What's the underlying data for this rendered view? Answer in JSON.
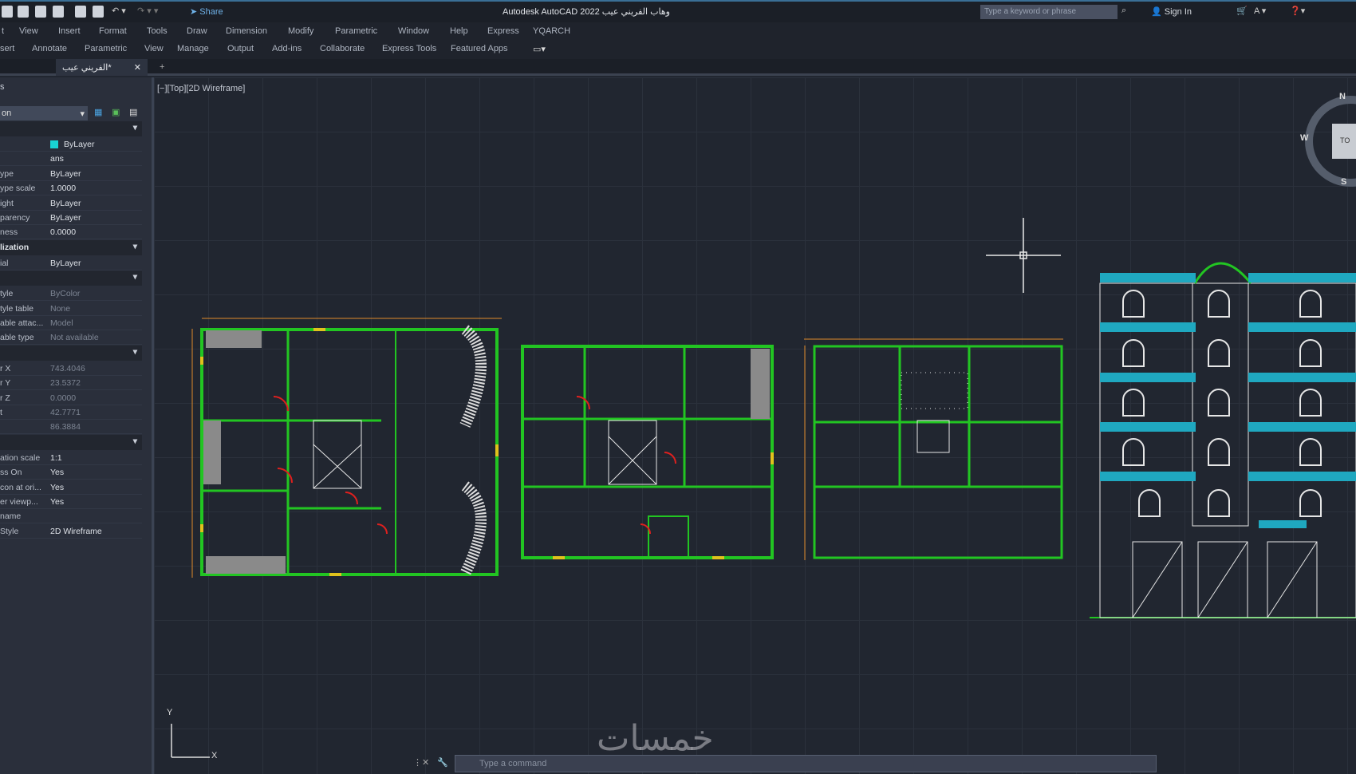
{
  "titlebar": {
    "share": "Share",
    "app_title": "Autodesk AutoCAD 2022  وهاب الفريني عيب",
    "search_placeholder": "Type a keyword or phrase",
    "sign_in": "Sign In"
  },
  "menu": [
    "t",
    "View",
    "Insert",
    "Format",
    "Tools",
    "Draw",
    "Dimension",
    "Modify",
    "Parametric",
    "Window",
    "Help",
    "Express",
    "YQARCH"
  ],
  "ribbon": [
    "sert",
    "Annotate",
    "Parametric",
    "View",
    "Manage",
    "Output",
    "Add-ins",
    "Collaborate",
    "Express Tools",
    "Featured Apps"
  ],
  "file_tab": {
    "label": "الفريني عيب*",
    "close": "✕",
    "new": "+"
  },
  "viewport": {
    "label": "[−][Top][2D Wireframe]",
    "viewcube": {
      "n": "N",
      "w": "W",
      "s": "S",
      "top": "TO"
    },
    "ucs": {
      "x": "X",
      "y": "Y"
    }
  },
  "panel": {
    "title": "s",
    "selector": "on",
    "sections": [
      {
        "header": "",
        "rows": [
          [
            "",
            "ByLayer"
          ],
          [
            "",
            "ans"
          ],
          [
            "ype",
            "ByLayer"
          ],
          [
            "ype scale",
            "1.0000"
          ],
          [
            "ight",
            "ByLayer"
          ],
          [
            "parency",
            "ByLayer"
          ],
          [
            "ness",
            "0.0000"
          ]
        ]
      },
      {
        "header": "lization",
        "rows": [
          [
            "ial",
            "ByLayer"
          ]
        ]
      },
      {
        "header": "",
        "rows": [
          [
            "tyle",
            "ByColor"
          ],
          [
            "tyle table",
            "None"
          ],
          [
            "able attac...",
            "Model"
          ],
          [
            "able type",
            "Not available"
          ]
        ]
      },
      {
        "header": "",
        "rows": [
          [
            "r X",
            "743.4046"
          ],
          [
            "r Y",
            "23.5372"
          ],
          [
            "r Z",
            "0.0000"
          ],
          [
            "t",
            "42.7771"
          ],
          [
            "",
            "86.3884"
          ]
        ]
      },
      {
        "header": "",
        "rows": [
          [
            "ation scale",
            "1:1"
          ],
          [
            "ss On",
            "Yes"
          ],
          [
            "con at ori...",
            "Yes"
          ],
          [
            "er viewp...",
            "Yes"
          ],
          [
            "name",
            ""
          ],
          [
            "Style",
            "2D Wireframe"
          ]
        ]
      }
    ]
  },
  "command": {
    "placeholder": "Type a command"
  },
  "watermark": "خمسات",
  "colors": {
    "wall": "#22c522",
    "dimension": "#e0c21c",
    "door": "#e0201e",
    "elevation_band": "#1fa8c0",
    "background": "#212630"
  }
}
